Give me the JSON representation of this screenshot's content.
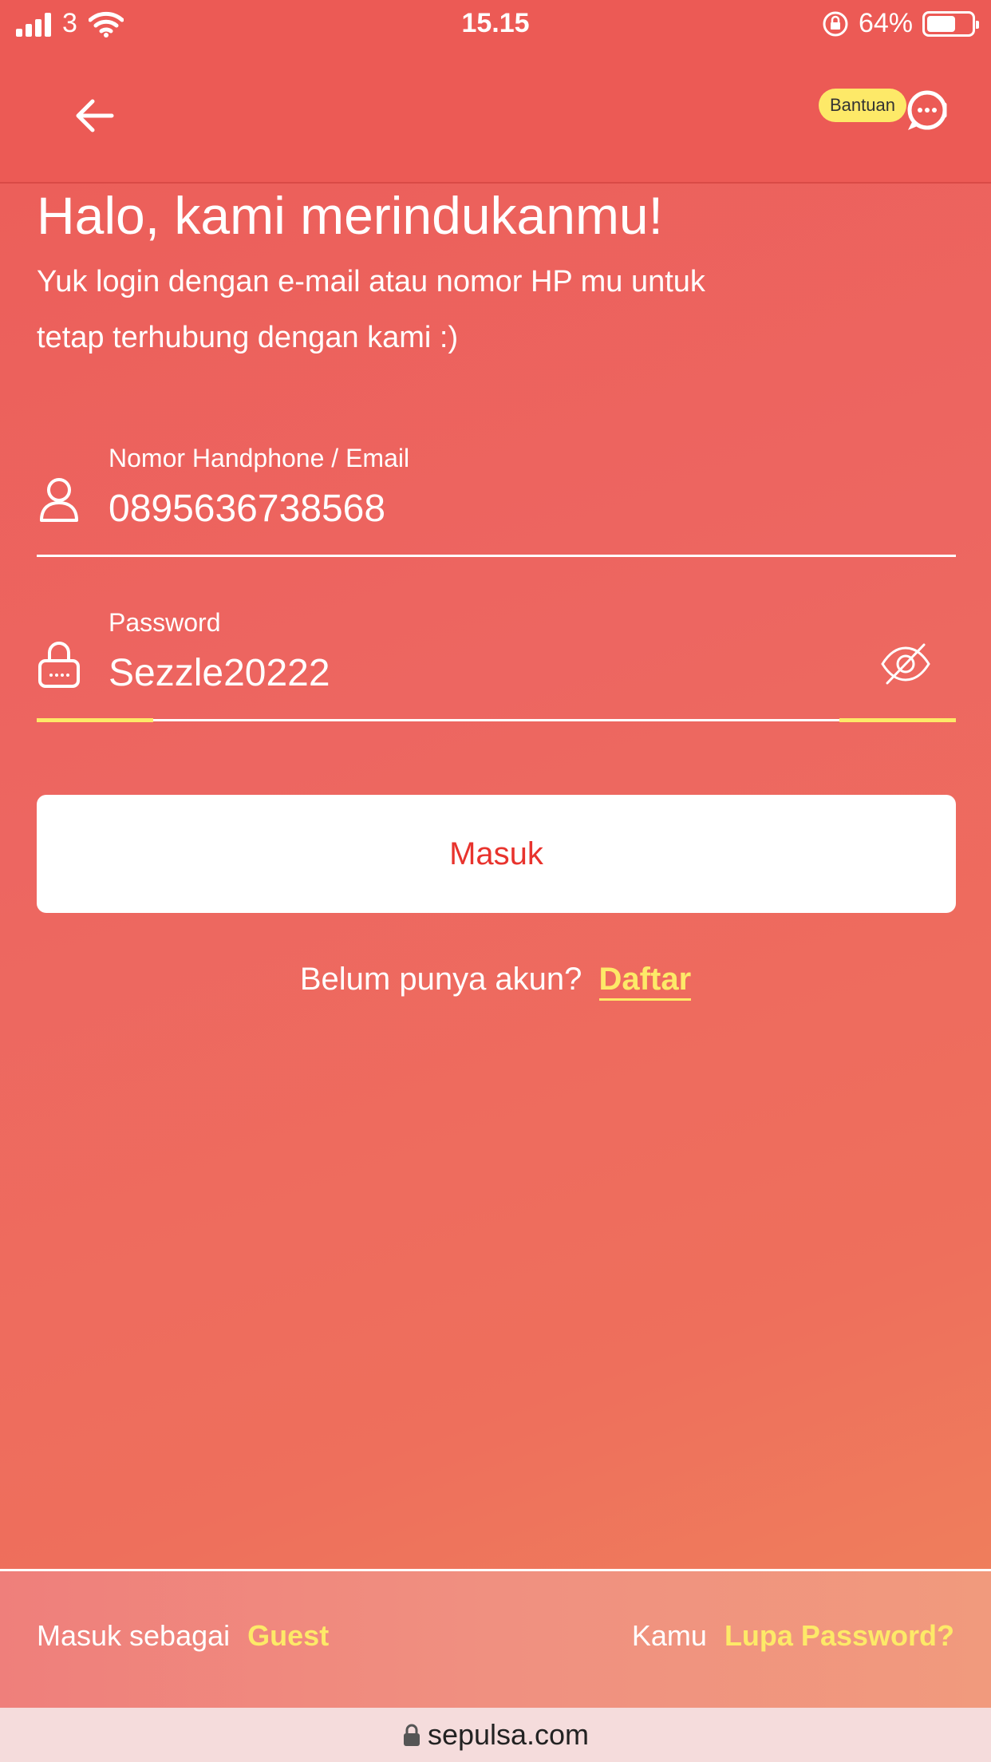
{
  "status": {
    "carrier": "3",
    "time": "15.15",
    "battery": "64%",
    "battery_level": 0.64
  },
  "header": {
    "help_label": "Bantuan"
  },
  "greeting": {
    "title": "Halo, kami merindukanmu!",
    "subtitle": "Yuk login dengan e-mail atau nomor HP mu untuk tetap terhubung dengan kami :)"
  },
  "form": {
    "email_label": "Nomor Handphone / Email",
    "email_value": "0895636738568",
    "password_label": "Password",
    "password_value": "Sezzle20222",
    "submit_label": "Masuk"
  },
  "signup": {
    "prompt": "Belum punya akun?",
    "link": "Daftar"
  },
  "footer": {
    "guest_prefix": "Masuk sebagai",
    "guest_link": "Guest",
    "forgot_prefix": "Kamu",
    "forgot_link": "Lupa Password?"
  },
  "browser": {
    "url": "sepulsa.com"
  },
  "colors": {
    "accent_yellow": "#fde968",
    "brand_red": "#ec5a55",
    "button_text": "#e8332d"
  },
  "icons": {
    "back": "arrow-left-icon",
    "help": "chat-support-icon",
    "user": "user-icon",
    "lock": "lock-icon",
    "eye": "eye-off-icon"
  }
}
